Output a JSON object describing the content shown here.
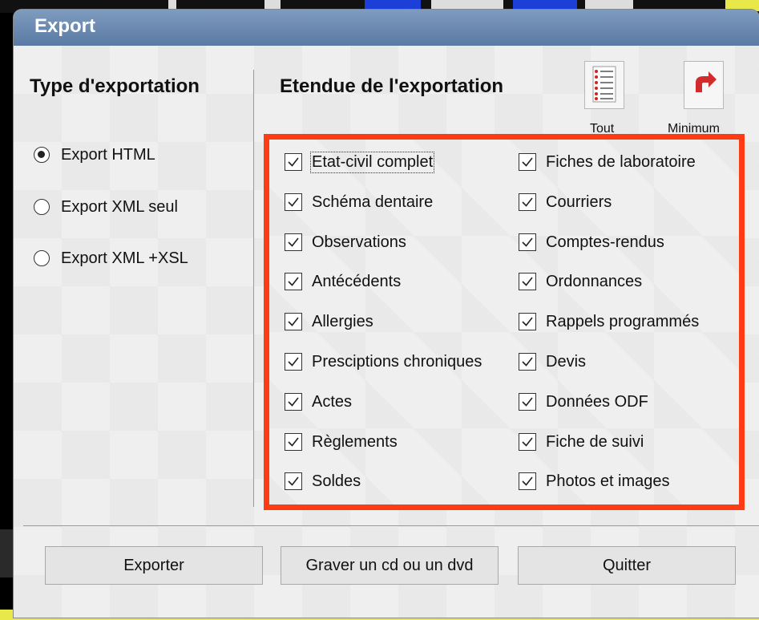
{
  "window": {
    "title": "Export"
  },
  "export_type": {
    "heading": "Type d'exportation",
    "options": [
      {
        "label": "Export HTML",
        "selected": true
      },
      {
        "label": "Export XML seul",
        "selected": false
      },
      {
        "label": "Export XML +XSL",
        "selected": false
      }
    ]
  },
  "export_scope": {
    "heading": "Etendue de l'exportation",
    "tools": [
      {
        "label": "Tout",
        "icon": "checklist-icon"
      },
      {
        "label": "Minimum",
        "icon": "undo-arrow-icon"
      }
    ],
    "left_items": [
      {
        "label": "Etat-civil complet",
        "checked": true
      },
      {
        "label": "Schéma dentaire",
        "checked": true
      },
      {
        "label": "Observations",
        "checked": true
      },
      {
        "label": "Antécédents",
        "checked": true
      },
      {
        "label": "Allergies",
        "checked": true
      },
      {
        "label": "Presciptions chroniques",
        "checked": true
      },
      {
        "label": "Actes",
        "checked": true
      },
      {
        "label": "Règlements",
        "checked": true
      },
      {
        "label": "Soldes",
        "checked": true
      }
    ],
    "right_items": [
      {
        "label": "Fiches de laboratoire",
        "checked": true
      },
      {
        "label": "Courriers",
        "checked": true
      },
      {
        "label": "Comptes-rendus",
        "checked": true
      },
      {
        "label": "Ordonnances",
        "checked": true
      },
      {
        "label": "Rappels programmés",
        "checked": true
      },
      {
        "label": "Devis",
        "checked": true
      },
      {
        "label": "Données ODF",
        "checked": true
      },
      {
        "label": "Fiche de suivi",
        "checked": true
      },
      {
        "label": "Photos et images",
        "checked": true
      }
    ]
  },
  "buttons": {
    "export": "Exporter",
    "burn": "Graver un cd ou un dvd",
    "quit": "Quitter"
  },
  "colors": {
    "highlight_frame": "#ff3b13",
    "titlebar": "#6a8ab2"
  }
}
